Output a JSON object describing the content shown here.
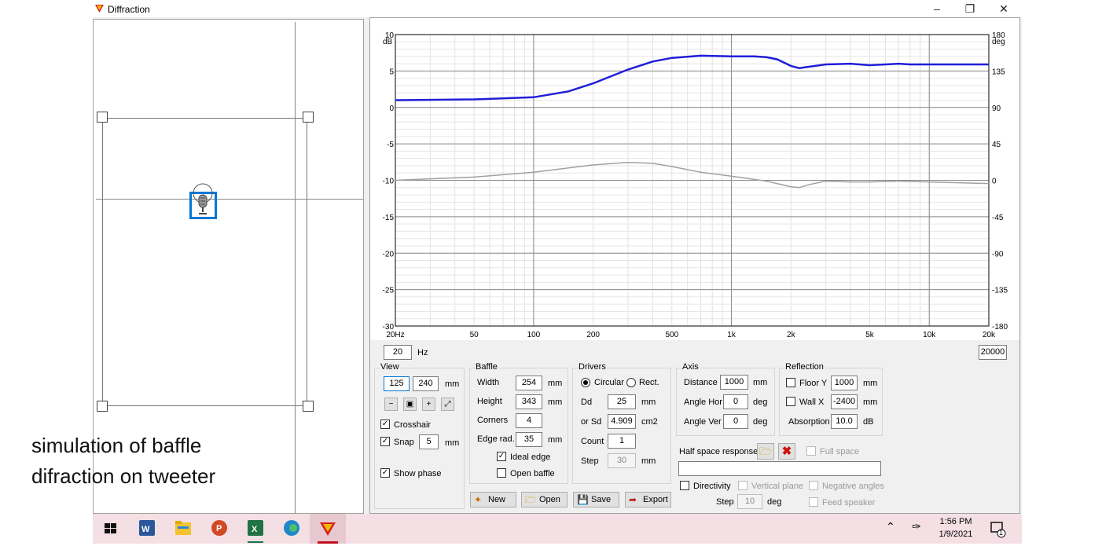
{
  "window": {
    "title": "Diffraction"
  },
  "caption": {
    "line1": "simulation of baffle",
    "line2": "difraction on tweeter"
  },
  "colors": {
    "magnitude_curve": "#1f1fd9",
    "phase_curve": "#a0a0a0",
    "accent": "#0078d7",
    "taskbar": "#f3dfe4"
  },
  "chart_data": {
    "type": "line",
    "x_scale": "log",
    "xlim": [
      20,
      20000
    ],
    "ylim": [
      -30,
      10
    ],
    "y2lim": [
      -180,
      180
    ],
    "ylabel": "dB",
    "y2label": "deg",
    "grid": true,
    "x_ticks": [
      "20Hz",
      "50",
      "100",
      "200",
      "500",
      "1k",
      "2k",
      "5k",
      "10k",
      "20k"
    ],
    "y_ticks": [
      "10",
      "5",
      "0",
      "-5",
      "-10",
      "-15",
      "-20",
      "-25",
      "-30"
    ],
    "y2_ticks": [
      "180",
      "135",
      "90",
      "45",
      "0",
      "-45",
      "-90",
      "-135",
      "-180"
    ],
    "series": [
      {
        "axis": "left",
        "x": [
          20,
          50,
          100,
          150,
          200,
          300,
          400,
          500,
          700,
          1000,
          1300,
          1500,
          1700,
          2000,
          2200,
          2500,
          3000,
          4000,
          5000,
          6000,
          7000,
          8000,
          10000,
          15000,
          20000
        ],
        "values": [
          1.0,
          1.1,
          1.4,
          2.2,
          3.3,
          5.2,
          6.3,
          6.8,
          7.1,
          7.0,
          7.0,
          6.9,
          6.6,
          5.7,
          5.4,
          5.6,
          5.9,
          6.0,
          5.8,
          5.9,
          6.0,
          5.9,
          5.9,
          5.9,
          5.9
        ]
      },
      {
        "axis": "right",
        "x": [
          20,
          50,
          100,
          200,
          300,
          400,
          500,
          700,
          1000,
          1500,
          2000,
          2200,
          2500,
          3000,
          4000,
          5000,
          7000,
          10000,
          20000
        ],
        "values": [
          0,
          4,
          10,
          19,
          22,
          21,
          17,
          10,
          5,
          -1,
          -8,
          -9,
          -5,
          -1,
          -2,
          -2,
          -1,
          -2,
          -4
        ]
      }
    ]
  },
  "freq": {
    "min": "20",
    "hz_label": "Hz",
    "max": "20000"
  },
  "view": {
    "title": "View",
    "x": "125",
    "y": "240",
    "unit": "mm",
    "crosshair_label": "Crosshair",
    "crosshair": true,
    "snap_label": "Snap",
    "snap": true,
    "snap_value": "5",
    "snap_unit": "mm",
    "show_phase_label": "Show phase",
    "show_phase": true
  },
  "baffle": {
    "title": "Baffle",
    "width_label": "Width",
    "width": "254",
    "height_label": "Height",
    "height": "343",
    "corners_label": "Corners",
    "corners": "4",
    "edge_label": "Edge rad.",
    "edge": "35",
    "unit": "mm",
    "ideal_edge_label": "Ideal edge",
    "ideal_edge": true,
    "open_baffle_label": "Open baffle",
    "open_baffle": false
  },
  "drivers": {
    "title": "Drivers",
    "circular_label": "Circular",
    "rect_label": "Rect.",
    "shape": "Circular",
    "dd_label": "Dd",
    "dd": "25",
    "dd_unit": "mm",
    "sd_label": "or Sd",
    "sd": "4.909",
    "sd_unit": "cm2",
    "count_label": "Count",
    "count": "1",
    "step_label": "Step",
    "step": "30",
    "step_unit": "mm"
  },
  "axis": {
    "title": "Axis",
    "distance_label": "Distance",
    "distance": "1000",
    "distance_unit": "mm",
    "hor_label": "Angle Hor",
    "hor": "0",
    "ver_label": "Angle Ver",
    "ver": "0",
    "deg": "deg"
  },
  "reflection": {
    "title": "Reflection",
    "floor_label": "Floor Y",
    "floor": "1000",
    "floor_checked": false,
    "wall_label": "Wall  X",
    "wall": "-2400",
    "wall_checked": false,
    "unit": "mm",
    "absorption_label": "Absorption",
    "absorption": "10.0",
    "absorption_unit": "dB"
  },
  "half_space": {
    "label": "Half space response",
    "full_space_label": "Full space",
    "path": "",
    "directivity_label": "Directivity",
    "vertical_plane_label": "Vertical plane",
    "negative_angles_label": "Negative angles",
    "feed_speaker_label": "Feed speaker",
    "step_label": "Step",
    "step": "10",
    "step_unit": "deg"
  },
  "buttons": {
    "new": "New",
    "open": "Open",
    "save": "Save",
    "export": "Export"
  },
  "taskbar": {
    "time": "1:56 PM",
    "date": "1/9/2021",
    "notification_count": "1"
  }
}
